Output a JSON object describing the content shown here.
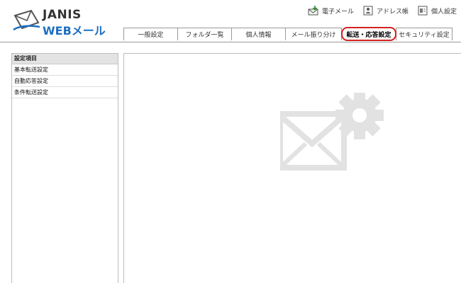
{
  "logo": {
    "line1": "JANIS",
    "line2": "WEBメール"
  },
  "toplinks": [
    {
      "label": "電子メール",
      "icon": "mail-download-icon"
    },
    {
      "label": "アドレス帳",
      "icon": "address-book-icon"
    },
    {
      "label": "個人設定",
      "icon": "settings-page-icon"
    }
  ],
  "tabs": [
    {
      "label": "一般設定"
    },
    {
      "label": "フォルダ一覧"
    },
    {
      "label": "個人情報"
    },
    {
      "label": "メール振り分け"
    },
    {
      "label": "転送・応答設定",
      "active": true
    },
    {
      "label": "セキュリティ設定"
    }
  ],
  "sidebar": {
    "header": "設定項目",
    "items": [
      {
        "label": "基本転送設定"
      },
      {
        "label": "自動応答設定"
      },
      {
        "label": "条件転送設定"
      }
    ]
  },
  "colors": {
    "accent_blue": "#1e6fc0",
    "active_tab_border": "#d42020",
    "watermark_gray": "#e2e2e2"
  }
}
